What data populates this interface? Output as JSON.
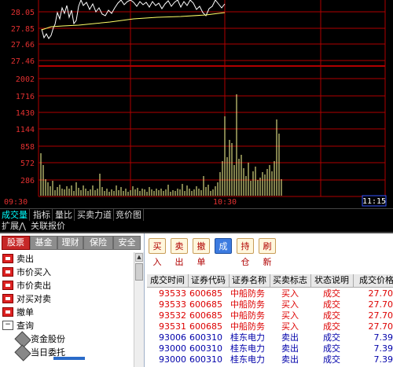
{
  "chart": {
    "price_labels": [
      "28.05",
      "27.85",
      "27.66",
      "27.46"
    ],
    "volume_labels": [
      "2002",
      "1716",
      "1430",
      "1144",
      "858",
      "572",
      "286"
    ],
    "time_labels": [
      "09:30",
      "10:30"
    ],
    "time_box": "11:15",
    "colors": {
      "grid": "#b00000",
      "price_line": "#ffffff",
      "avg_line": "#ffff66",
      "volume": "#ffff99",
      "label": "#e33030",
      "time_label": "#e33030"
    }
  },
  "chart_tabs": [
    {
      "label": "成交量",
      "active": true
    },
    {
      "label": "指标",
      "active": false
    },
    {
      "label": "量比",
      "active": false
    },
    {
      "label": "买卖力道",
      "active": false
    },
    {
      "label": "竞价图",
      "active": false
    }
  ],
  "sub_tabs": [
    "扩展⋀",
    "关联报价"
  ],
  "category_tabs": [
    {
      "label": "股票",
      "active": true
    },
    {
      "label": "基金",
      "active": false
    },
    {
      "label": "理财",
      "active": false
    },
    {
      "label": "保险",
      "active": false
    },
    {
      "label": "安全",
      "active": false
    }
  ],
  "tree": [
    {
      "label": "卖出",
      "icon": "sell-icon"
    },
    {
      "label": "市价买入",
      "icon": "market-buy-icon"
    },
    {
      "label": "市价卖出",
      "icon": "market-sell-icon"
    },
    {
      "label": "对买对卖",
      "icon": "swap-trade-icon"
    },
    {
      "label": "撤单",
      "icon": "cancel-order-icon"
    },
    {
      "label": "查询",
      "icon": "collapse-icon"
    },
    {
      "label": "资金股份",
      "icon": "funds-icon"
    },
    {
      "label": "当日委托",
      "icon": "orders-icon"
    }
  ],
  "toolbar": [
    "买入",
    "卖出",
    "撤单",
    "成交",
    "持仓",
    "刷新"
  ],
  "grid": {
    "headers": [
      "成交时间",
      "证券代码",
      "证券名称",
      "买卖标志",
      "状态说明",
      "成交价格"
    ],
    "rows": [
      {
        "time": "93533",
        "code": "600685",
        "name": "中船防务",
        "side": "买入",
        "status": "成交",
        "price": "27.700"
      },
      {
        "time": "93533",
        "code": "600685",
        "name": "中船防务",
        "side": "买入",
        "status": "成交",
        "price": "27.700"
      },
      {
        "time": "93532",
        "code": "600685",
        "name": "中船防务",
        "side": "买入",
        "status": "成交",
        "price": "27.700"
      },
      {
        "time": "93531",
        "code": "600685",
        "name": "中船防务",
        "side": "买入",
        "status": "成交",
        "price": "27.700"
      },
      {
        "time": "93006",
        "code": "600310",
        "name": "桂东电力",
        "side": "卖出",
        "status": "成交",
        "price": "7.390"
      },
      {
        "time": "93000",
        "code": "600310",
        "name": "桂东电力",
        "side": "卖出",
        "status": "成交",
        "price": "7.390"
      },
      {
        "time": "93000",
        "code": "600310",
        "name": "桂东电力",
        "side": "卖出",
        "status": "成交",
        "price": "7.390"
      }
    ]
  }
}
